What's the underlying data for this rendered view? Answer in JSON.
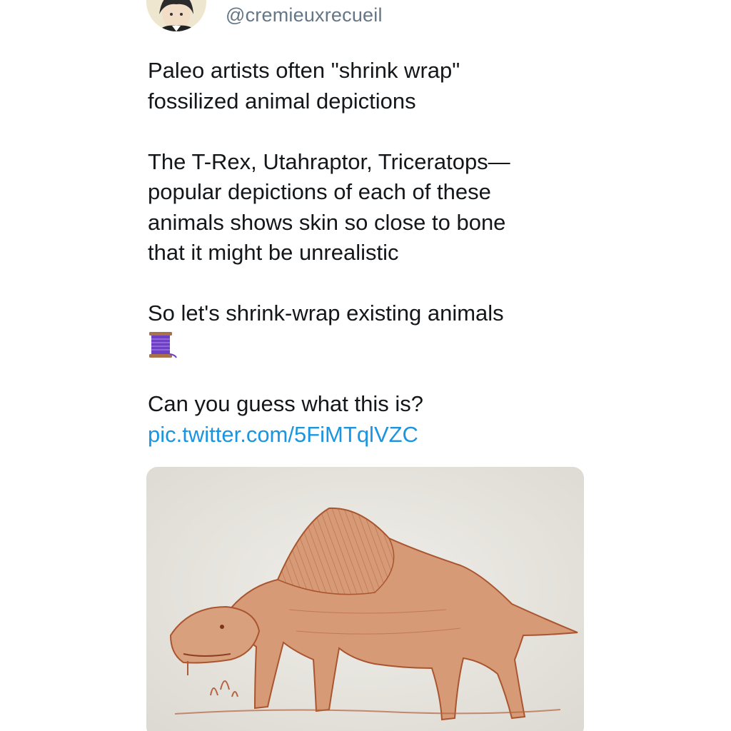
{
  "tweet": {
    "handle": "@cremieuxrecueil",
    "avatar_icon": "portrait-avatar-icon",
    "paragraphs": [
      "Paleo artists often \"shrink wrap\"\nfossilized animal depictions",
      "The T-Rex, Utahraptor, Triceratops—\npopular depictions of each of these\nanimals shows skin so close to bone\nthat it might be unrealistic",
      "So let's shrink-wrap existing animals"
    ],
    "thread_icon": "spool-of-thread-icon",
    "question": "Can you guess what this is?",
    "link": "pic.twitter.com/5FiMTqlVZC",
    "media_icon": "shrink-wrapped-animal-illustration"
  },
  "colors": {
    "text": "#14171a",
    "handle": "#657786",
    "link": "#1b95e0",
    "media_bg": "#e9e7e2",
    "sketch": "#b4633d"
  }
}
